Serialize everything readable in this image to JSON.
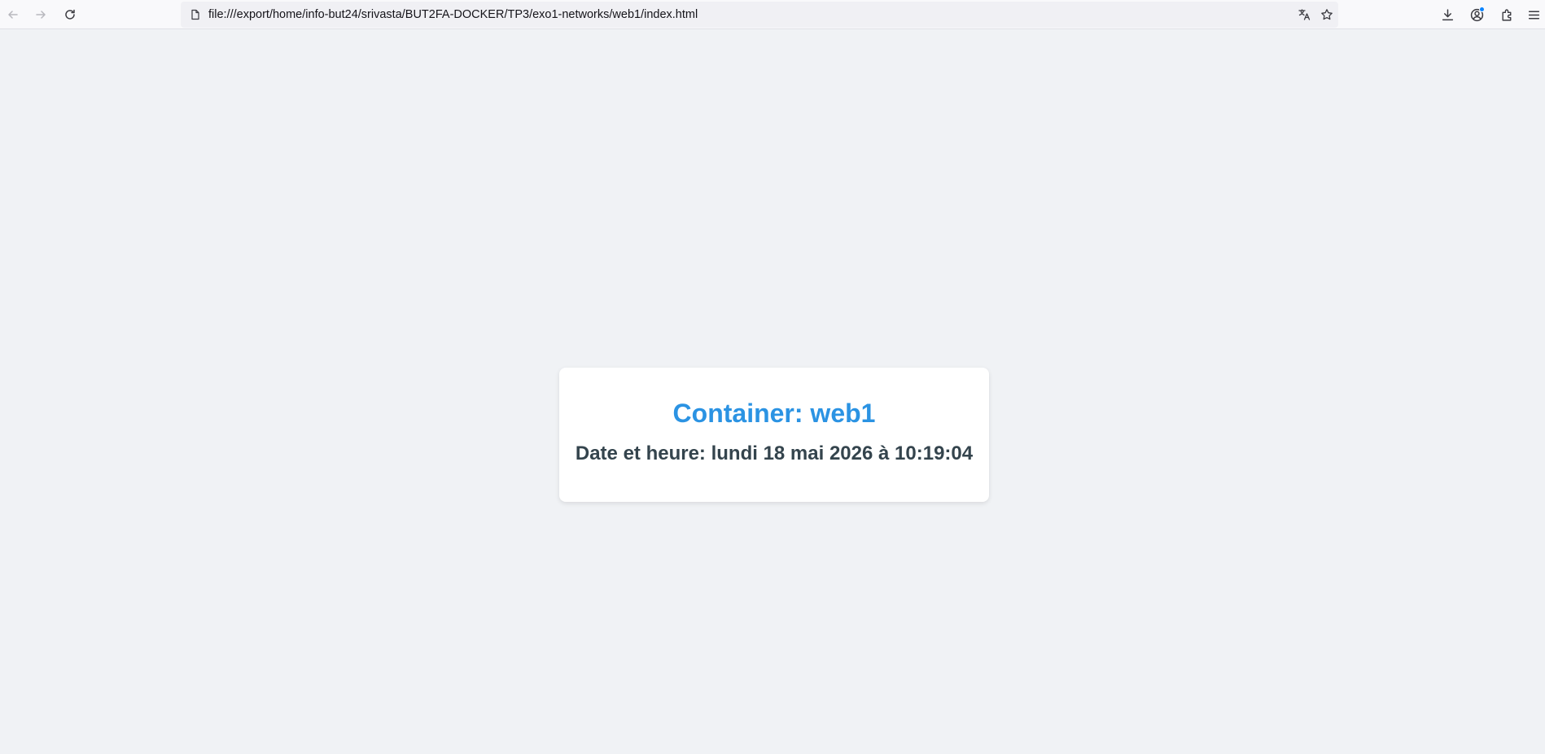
{
  "browser": {
    "url": "file:///export/home/info-but24/srivasta/BUT2FA-DOCKER/TP3/exo1-networks/web1/index.html",
    "icons": {
      "back": "arrow-left-icon",
      "forward": "arrow-right-icon",
      "reload": "reload-icon",
      "page": "page-icon",
      "translate": "translate-icon",
      "bookmark": "star-icon",
      "downloads": "download-icon",
      "account": "account-icon",
      "extensions": "puzzle-icon",
      "menu": "hamburger-menu-icon"
    },
    "colors": {
      "toolbar_bg": "#f9f9fb",
      "urlbar_bg": "#f0f0f4",
      "account_badge": "#0a84ff"
    }
  },
  "page": {
    "title": "Container: web1",
    "datetime": "Date et heure: lundi 18 mai 2026 à 10:19:04",
    "colors": {
      "background": "#f0f2f5",
      "card": "#ffffff",
      "title": "#2b93e3",
      "text": "#34444d"
    }
  }
}
